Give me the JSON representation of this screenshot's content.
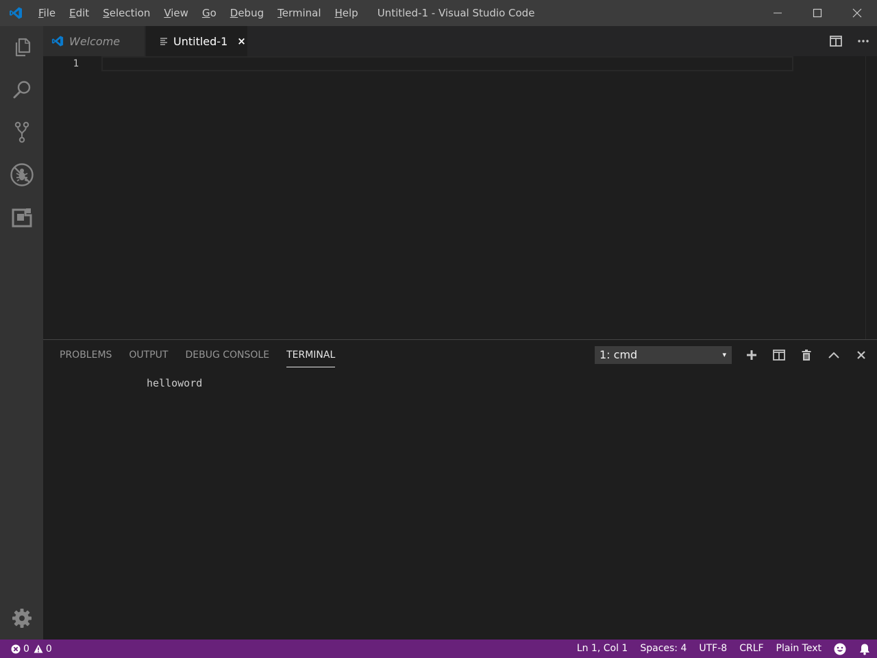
{
  "window": {
    "title": "Untitled-1 - Visual Studio Code",
    "logo_icon": "vscode-logo-icon"
  },
  "menu": {
    "items": [
      {
        "mnemonic": "F",
        "rest": "ile"
      },
      {
        "mnemonic": "E",
        "rest": "dit"
      },
      {
        "mnemonic": "S",
        "rest": "election"
      },
      {
        "mnemonic": "V",
        "rest": "iew"
      },
      {
        "mnemonic": "G",
        "rest": "o"
      },
      {
        "mnemonic": "D",
        "rest": "ebug"
      },
      {
        "mnemonic": "T",
        "rest": "erminal"
      },
      {
        "mnemonic": "H",
        "rest": "elp"
      }
    ]
  },
  "window_controls": [
    "minimize-icon",
    "maximize-icon",
    "close-icon"
  ],
  "activity_bar": {
    "items": [
      "explorer-icon",
      "search-icon",
      "source-control-icon",
      "debug-icon",
      "extensions-icon"
    ],
    "settings_icon": "gear-icon"
  },
  "tabs": [
    {
      "label": "Welcome",
      "icon": "vscode-logo-icon",
      "active": false
    },
    {
      "label": "Untitled-1",
      "icon": "file-lines-icon",
      "close": "×",
      "active": true
    }
  ],
  "editor": {
    "line_numbers": [
      "1"
    ],
    "actions": [
      "split-editor-icon",
      "more-icon"
    ]
  },
  "panel": {
    "tabs": [
      {
        "label": "PROBLEMS",
        "active": false
      },
      {
        "label": "OUTPUT",
        "active": false
      },
      {
        "label": "DEBUG CONSOLE",
        "active": false
      },
      {
        "label": "TERMINAL",
        "active": true
      }
    ],
    "terminal_select": {
      "value": "1: cmd",
      "caret": "▾"
    },
    "actions": [
      "plus-icon",
      "split-terminal-icon",
      "trash-icon",
      "chevron-up-icon",
      "close-icon"
    ],
    "terminal_output": "helloword"
  },
  "status_bar": {
    "errors": "0",
    "warnings": "0",
    "position": "Ln 1, Col 1",
    "indentation": "Spaces: 4",
    "encoding": "UTF-8",
    "line_ending": "CRLF",
    "language": "Plain Text",
    "feedback_icon": "smiley-icon",
    "notifications_icon": "bell-icon"
  },
  "colors": {
    "accent_blue": "#0a7acc",
    "status_bar": "#68217a",
    "titlebar": "#3c3c3c",
    "activitybar": "#333333",
    "editor_bg": "#1e1e1e"
  }
}
